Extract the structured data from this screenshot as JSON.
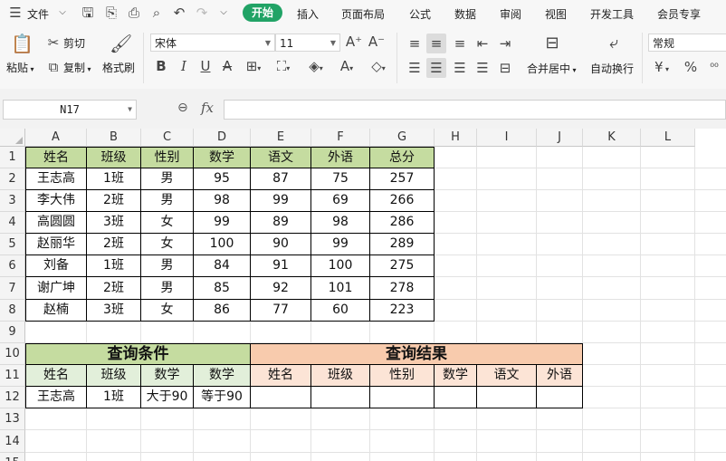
{
  "menu": {
    "file_label": "文件",
    "tabs": [
      "开始",
      "插入",
      "页面布局",
      "公式",
      "数据",
      "审阅",
      "视图",
      "开发工具",
      "会员专享"
    ]
  },
  "ribbon": {
    "paste": "粘贴",
    "cut": "剪切",
    "copy": "复制",
    "format_painter": "格式刷",
    "font_name": "宋体",
    "font_size": "11",
    "merge_center": "合并居中",
    "wrap_text": "自动换行",
    "number_format": "常规",
    "currency_symbol": "¥",
    "percent_symbol": "%"
  },
  "formula_bar": {
    "name_box": "N17",
    "fx": "fx",
    "value": ""
  },
  "columns": [
    "A",
    "B",
    "C",
    "D",
    "E",
    "F",
    "G",
    "H",
    "I",
    "J",
    "K",
    "L"
  ],
  "rows": [
    "1",
    "2",
    "3",
    "4",
    "5",
    "6",
    "7",
    "8",
    "9",
    "10",
    "11",
    "12",
    "13",
    "14",
    "15"
  ],
  "table": {
    "headers": [
      "姓名",
      "班级",
      "性别",
      "数学",
      "语文",
      "外语",
      "总分"
    ],
    "rows": [
      [
        "王志高",
        "1班",
        "男",
        "95",
        "87",
        "75",
        "257"
      ],
      [
        "李大伟",
        "2班",
        "男",
        "98",
        "99",
        "69",
        "266"
      ],
      [
        "高圆圆",
        "3班",
        "女",
        "99",
        "89",
        "98",
        "286"
      ],
      [
        "赵丽华",
        "2班",
        "女",
        "100",
        "90",
        "99",
        "289"
      ],
      [
        "刘备",
        "1班",
        "男",
        "84",
        "91",
        "100",
        "275"
      ],
      [
        "谢广坤",
        "2班",
        "男",
        "85",
        "92",
        "101",
        "278"
      ],
      [
        "赵楠",
        "3班",
        "女",
        "86",
        "77",
        "60",
        "223"
      ]
    ]
  },
  "query": {
    "condition_title": "查询条件",
    "result_title": "查询结果",
    "condition_headers": [
      "姓名",
      "班级",
      "数学",
      "数学"
    ],
    "condition_values": [
      "王志高",
      "1班",
      "大于90",
      "等于90"
    ],
    "result_headers": [
      "姓名",
      "班级",
      "性别",
      "数学",
      "语文",
      "外语"
    ]
  },
  "colors": {
    "accent": "#21a366",
    "header_green": "#c5dca0",
    "header_light_green": "#e2efda",
    "header_orange": "#f8cbad",
    "header_light_orange": "#fce4d6"
  }
}
